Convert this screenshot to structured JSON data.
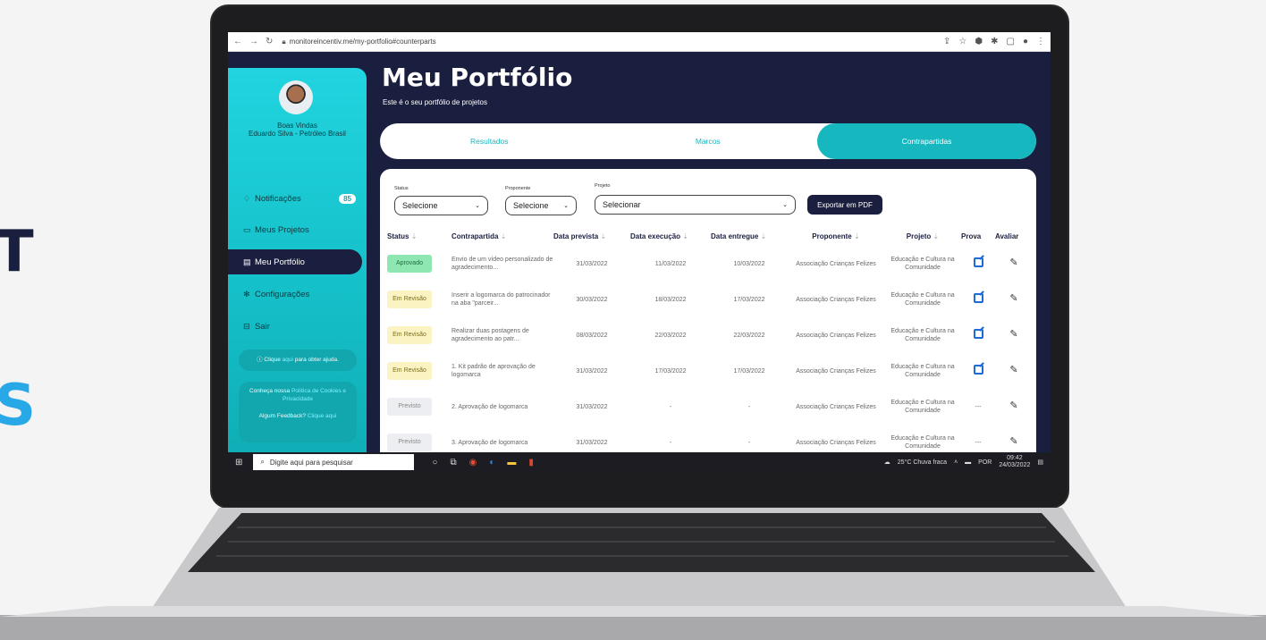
{
  "side_text": {
    "letter1": "T",
    "letter2": "S"
  },
  "browser": {
    "url": "monitoreincentiv.me/my-portfolio#counterparts"
  },
  "sidebar": {
    "welcome": "Boas Vindas",
    "user": "Eduardo Silva - Petróleo Brasil",
    "items": [
      {
        "label": "Notificações",
        "icon": "bell-icon",
        "badge": "85"
      },
      {
        "label": "Meus Projetos",
        "icon": "folder-icon"
      },
      {
        "label": "Meu Portfólio",
        "icon": "portfolio-icon"
      },
      {
        "label": "Configurações",
        "icon": "gear-icon"
      },
      {
        "label": "Sair",
        "icon": "exit-icon"
      }
    ],
    "help_text_a": "Clique",
    "help_link": "aqui",
    "help_text_b": "para obter ajuda.",
    "policy_text": "Conheça nossa",
    "policy_link": "Política de Cookies e Privacidade",
    "feedback_text": "Algum Feedback?",
    "feedback_link": "Clique aqui"
  },
  "main": {
    "title": "Meu Portfólio",
    "subtitle": "Este é o seu portfólio de projetos",
    "tabs": [
      "Resultados",
      "Marcos",
      "Contrapartidas"
    ]
  },
  "filters": {
    "status_label": "Status",
    "status_value": "Selecione",
    "proponente_label": "Proponente",
    "proponente_value": "Selecione",
    "projeto_label": "Projeto",
    "projeto_value": "Selecionar",
    "export_label": "Exportar em PDF"
  },
  "table": {
    "headers": [
      "Status",
      "Contrapartida",
      "Data prevista",
      "Data execução",
      "Data entregue",
      "Proponente",
      "Projeto",
      "Prova",
      "Avaliar"
    ],
    "rows": [
      {
        "status": "Aprovado",
        "contrapartida": "Envio de um vídeo personalizado de agradecimento...",
        "prevista": "31/03/2022",
        "execucao": "11/03/2022",
        "entregue": "10/03/2022",
        "proponente": "Associação Crianças Felizes",
        "projeto": "Educação e Cultura na Comunidade",
        "prova": true
      },
      {
        "status": "Em Revisão",
        "contrapartida": "Inserir a logomarca do patrocinador na aba \"parceir...",
        "prevista": "30/03/2022",
        "execucao": "18/03/2022",
        "entregue": "17/03/2022",
        "proponente": "Associação Crianças Felizes",
        "projeto": "Educação e Cultura na Comunidade",
        "prova": true
      },
      {
        "status": "Em Revisão",
        "contrapartida": "Realizar duas postagens de agradecimento ao patr...",
        "prevista": "08/03/2022",
        "execucao": "22/03/2022",
        "entregue": "22/03/2022",
        "proponente": "Associação Crianças Felizes",
        "projeto": "Educação e Cultura na Comunidade",
        "prova": true
      },
      {
        "status": "Em Revisão",
        "contrapartida": "1. Kit padrão de aprovação de logomarca",
        "prevista": "31/03/2022",
        "execucao": "17/03/2022",
        "entregue": "17/03/2022",
        "proponente": "Associação Crianças Felizes",
        "projeto": "Educação e Cultura na Comunidade",
        "prova": true
      },
      {
        "status": "Previsto",
        "contrapartida": "2. Aprovação de logomarca",
        "prevista": "31/03/2022",
        "execucao": "-",
        "entregue": "-",
        "proponente": "Associação Crianças Felizes",
        "projeto": "Educação e Cultura na Comunidade",
        "prova": false
      },
      {
        "status": "Previsto",
        "contrapartida": "3. Aprovação de logomarca",
        "prevista": "31/03/2022",
        "execucao": "-",
        "entregue": "-",
        "proponente": "Associação Crianças Felizes",
        "projeto": "Educação e Cultura na Comunidade",
        "prova": false
      }
    ]
  },
  "taskbar": {
    "search_placeholder": "Digite aqui para pesquisar",
    "weather": "25°C Chuva fraca",
    "lang": "POR",
    "time": "09:42",
    "date": "24/03/2022"
  },
  "colors": {
    "accent": "#17b7bf",
    "navy": "#1b1f3f",
    "side_letter": "#29a8e8"
  }
}
